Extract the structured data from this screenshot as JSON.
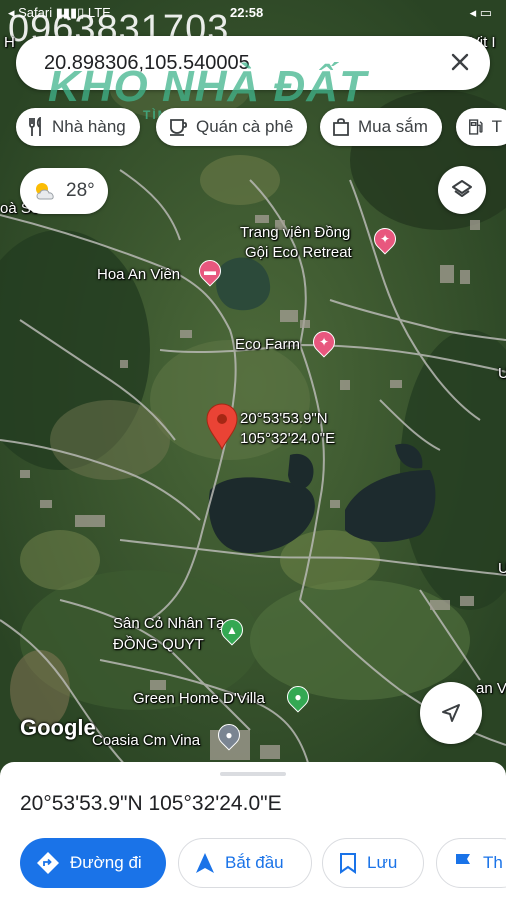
{
  "status_bar": {
    "left": "◂ Safari  ▮▮▮▯ LTE",
    "time": "22:58",
    "right": "◂ ▭"
  },
  "watermark": {
    "phone": "0963831703",
    "logo": "KHO NHÀ ĐẤT",
    "logo_sub": "TÌM LÀ THẤY"
  },
  "search": {
    "query": "20.898306,105.540005",
    "clear_icon": "close-icon"
  },
  "chips": [
    {
      "label": "Nhà hàng",
      "icon": "restaurant-icon"
    },
    {
      "label": "Quán cà phê",
      "icon": "coffee-icon"
    },
    {
      "label": "Mua sắm",
      "icon": "shopping-bag-icon"
    },
    {
      "label": "T",
      "icon": "gas-station-icon"
    }
  ],
  "weather": {
    "temp": "28°",
    "icon": "partly-cloudy-icon"
  },
  "map_labels": {
    "top_left": "H",
    "top_right": "Vit I",
    "left_edge": "oà Sơ",
    "trang_vien_line1": "Trang viên Đồng",
    "trang_vien_line2": "Gội Eco Retreat",
    "hoa_an_vien": "Hoa An Viên",
    "eco_farm": "Eco Farm",
    "pin_lat": "20°53'53.9\"N",
    "pin_lng": "105°32'24.0\"E",
    "san_co_line1": "Sân Cỏ Nhân Tạo",
    "san_co_line2": "ĐỒNG QUYT",
    "green_home": "Green Home D'Villa",
    "coasia": "Coasia Cm Vina",
    "right_edge_u1": "U",
    "right_edge_u2": "U",
    "right_edge_an": "an V"
  },
  "google_logo": "Google",
  "sheet": {
    "coords": "20°53'53.9\"N 105°32'24.0\"E",
    "actions": [
      {
        "label": "Đường đi",
        "icon": "directions-icon"
      },
      {
        "label": "Bắt đầu",
        "icon": "navigation-arrow-icon"
      },
      {
        "label": "Lưu",
        "icon": "bookmark-icon"
      },
      {
        "label": "Th",
        "icon": "flag-icon"
      }
    ]
  },
  "colors": {
    "accent": "#1a73e8",
    "pin_red": "#ea4335",
    "poi_pink": "#e8577e",
    "poi_green": "#34a853"
  }
}
